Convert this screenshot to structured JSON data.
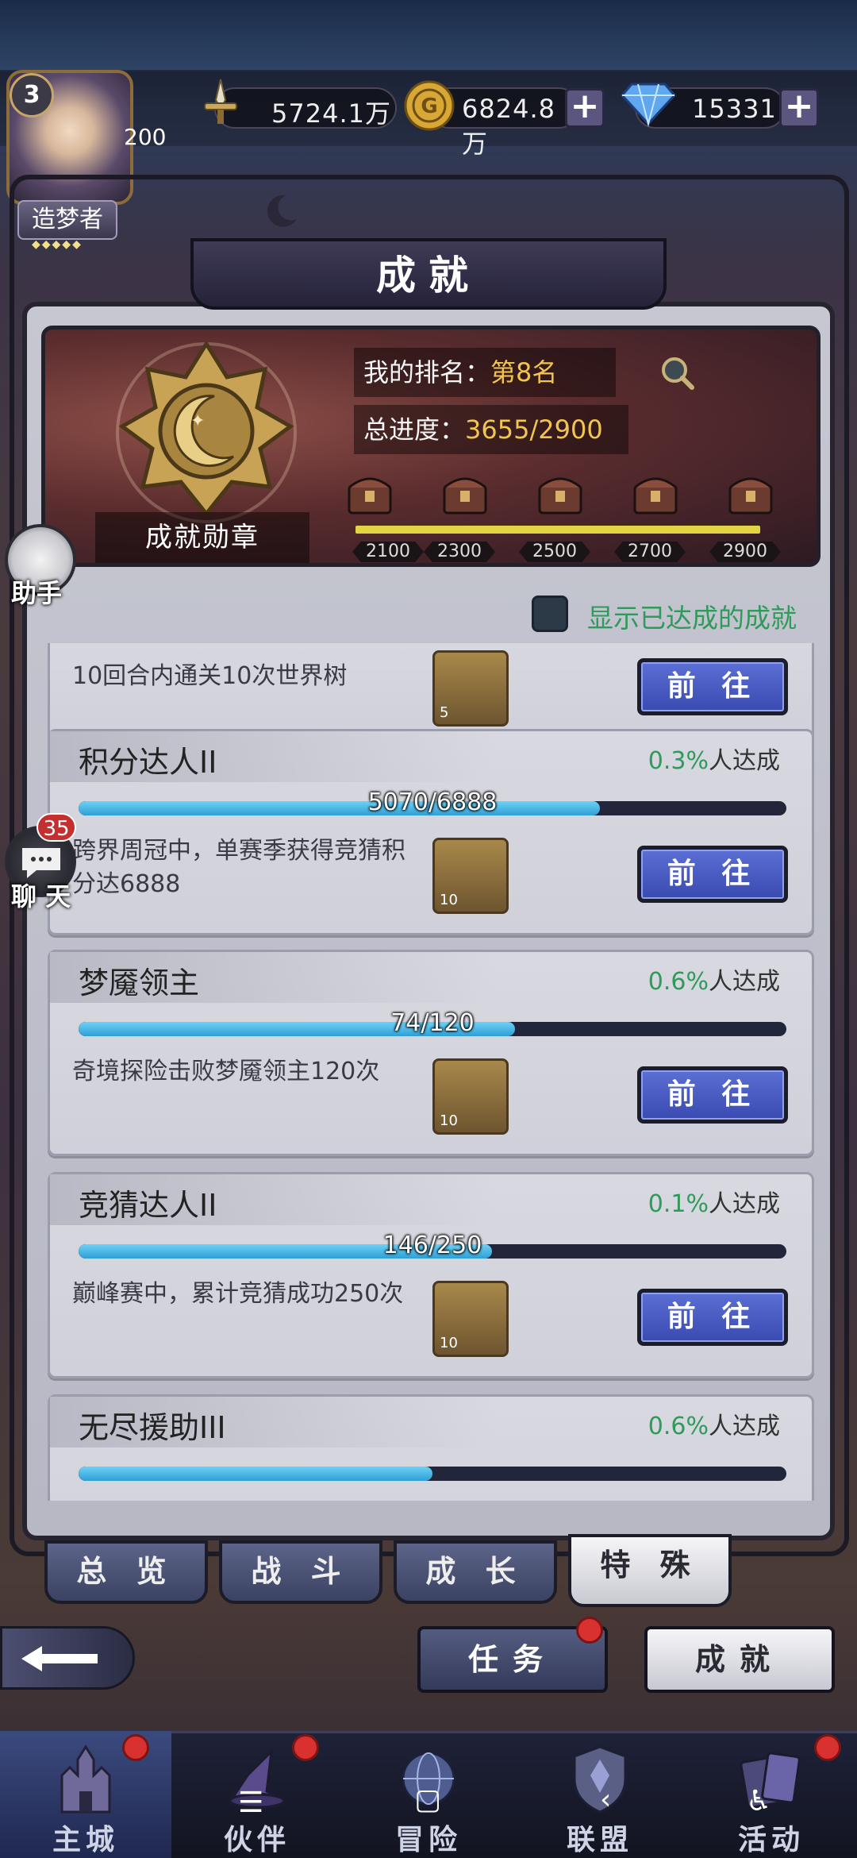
{
  "resources": {
    "power": "5724.1万",
    "gold": "6824.8万",
    "diamond": "15331",
    "player_level": "3",
    "player_title": "造梦者",
    "player_points": "200"
  },
  "header": {
    "title": "成就"
  },
  "summary": {
    "medal_name": "成就勋章",
    "rank_label": "我的排名：",
    "rank_value": "第8名",
    "progress_label": "总进度：",
    "progress_value": "3655/2900",
    "milestones": [
      "2100",
      "2300",
      "2500",
      "2700",
      "2900"
    ],
    "progress_fill": 1.0
  },
  "toggle": {
    "label": "显示已达成的成就"
  },
  "achievements": [
    {
      "title": "",
      "percent": "",
      "percent_suffix": "",
      "progress_text": "",
      "progress": null,
      "desc": "10回合内通关10次世界树",
      "reward_count": "5",
      "button": "前 往"
    },
    {
      "title": "积分达人II",
      "percent": "0.3%",
      "percent_suffix": "人达成",
      "progress_text": "5070/6888",
      "progress": 0.736,
      "desc": "跨界周冠中，单赛季获得竞猜积分达6888",
      "reward_count": "10",
      "button": "前 往"
    },
    {
      "title": "梦魇领主",
      "percent": "0.6%",
      "percent_suffix": "人达成",
      "progress_text": "74/120",
      "progress": 0.617,
      "desc": "奇境探险击败梦魇领主120次",
      "reward_count": "10",
      "button": "前 往"
    },
    {
      "title": "竞猜达人II",
      "percent": "0.1%",
      "percent_suffix": "人达成",
      "progress_text": "146/250",
      "progress": 0.584,
      "desc": "巅峰赛中，累计竞猜成功250次",
      "reward_count": "10",
      "button": "前 往"
    },
    {
      "title": "无尽援助III",
      "percent": "0.6%",
      "percent_suffix": "人达成",
      "progress_text": "",
      "progress": null,
      "desc": "",
      "reward_count": "",
      "button": ""
    }
  ],
  "side": {
    "assistant": "助手",
    "chat": "聊 天",
    "chat_badge": "35"
  },
  "tabs": [
    "总 览",
    "战 斗",
    "成 长",
    "特 殊"
  ],
  "active_tab": 3,
  "mode_buttons": {
    "task": "任务",
    "achievement": "成就"
  },
  "nav": [
    {
      "label": "主城",
      "icon": "castle-icon"
    },
    {
      "label": "伙伴",
      "icon": "witch-hat-icon"
    },
    {
      "label": "冒险",
      "icon": "globe-icon"
    },
    {
      "label": "联盟",
      "icon": "shield-icon"
    },
    {
      "label": "活动",
      "icon": "cards-icon"
    }
  ],
  "colors": {
    "accent_blue": "#394ab0",
    "progress_blue": "#2ea0d6",
    "success_green": "#2f9a5a",
    "gold": "#f2c550",
    "alert_red": "#d93030"
  }
}
